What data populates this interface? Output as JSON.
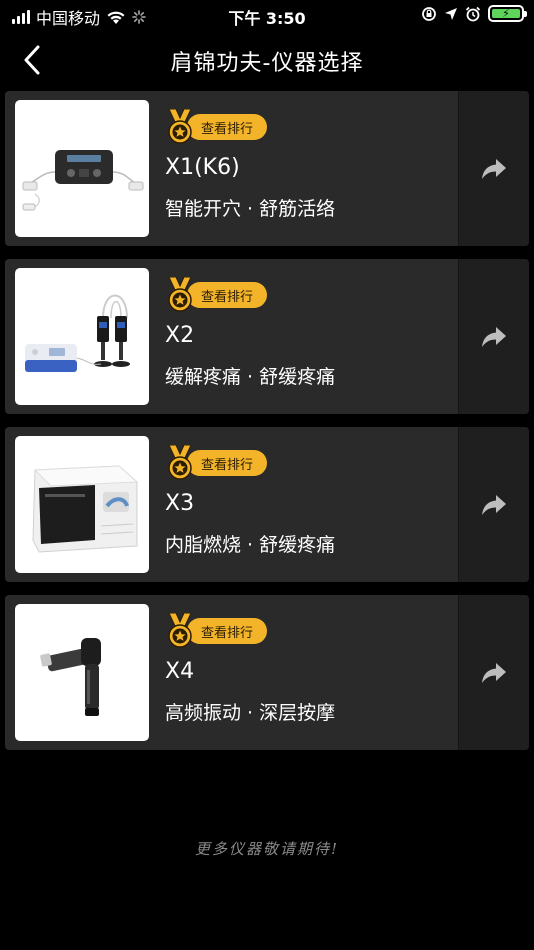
{
  "status_bar": {
    "carrier": "中国移动",
    "time": "下午 3:50",
    "battery_charging": true,
    "icons": [
      "signal-icon",
      "wifi-icon",
      "loading-icon",
      "orientation-lock-icon",
      "location-icon",
      "alarm-icon",
      "battery-icon"
    ]
  },
  "nav": {
    "title": "肩锦功夫-仪器选择",
    "back_icon": "chevron-left-icon"
  },
  "devices": [
    {
      "rank_label": "查看排行",
      "name": "X1(K6)",
      "desc": "智能开穴 · 舒筋活络",
      "share_icon": "share-arrow-icon"
    },
    {
      "rank_label": "查看排行",
      "name": "X2",
      "desc": "缓解疼痛 · 舒缓疼痛",
      "share_icon": "share-arrow-icon"
    },
    {
      "rank_label": "查看排行",
      "name": "X3",
      "desc": "内脂燃烧 · 舒缓疼痛",
      "share_icon": "share-arrow-icon"
    },
    {
      "rank_label": "查看排行",
      "name": "X4",
      "desc": "高频振动 · 深层按摩",
      "share_icon": "share-arrow-icon"
    }
  ],
  "footer": {
    "note": "更多仪器敬请期待!"
  },
  "colors": {
    "background": "#000000",
    "card": "#2a2a2a",
    "share_zone": "#1f1f1f",
    "badge": "#f4b42a",
    "battery": "#5fd45a"
  }
}
